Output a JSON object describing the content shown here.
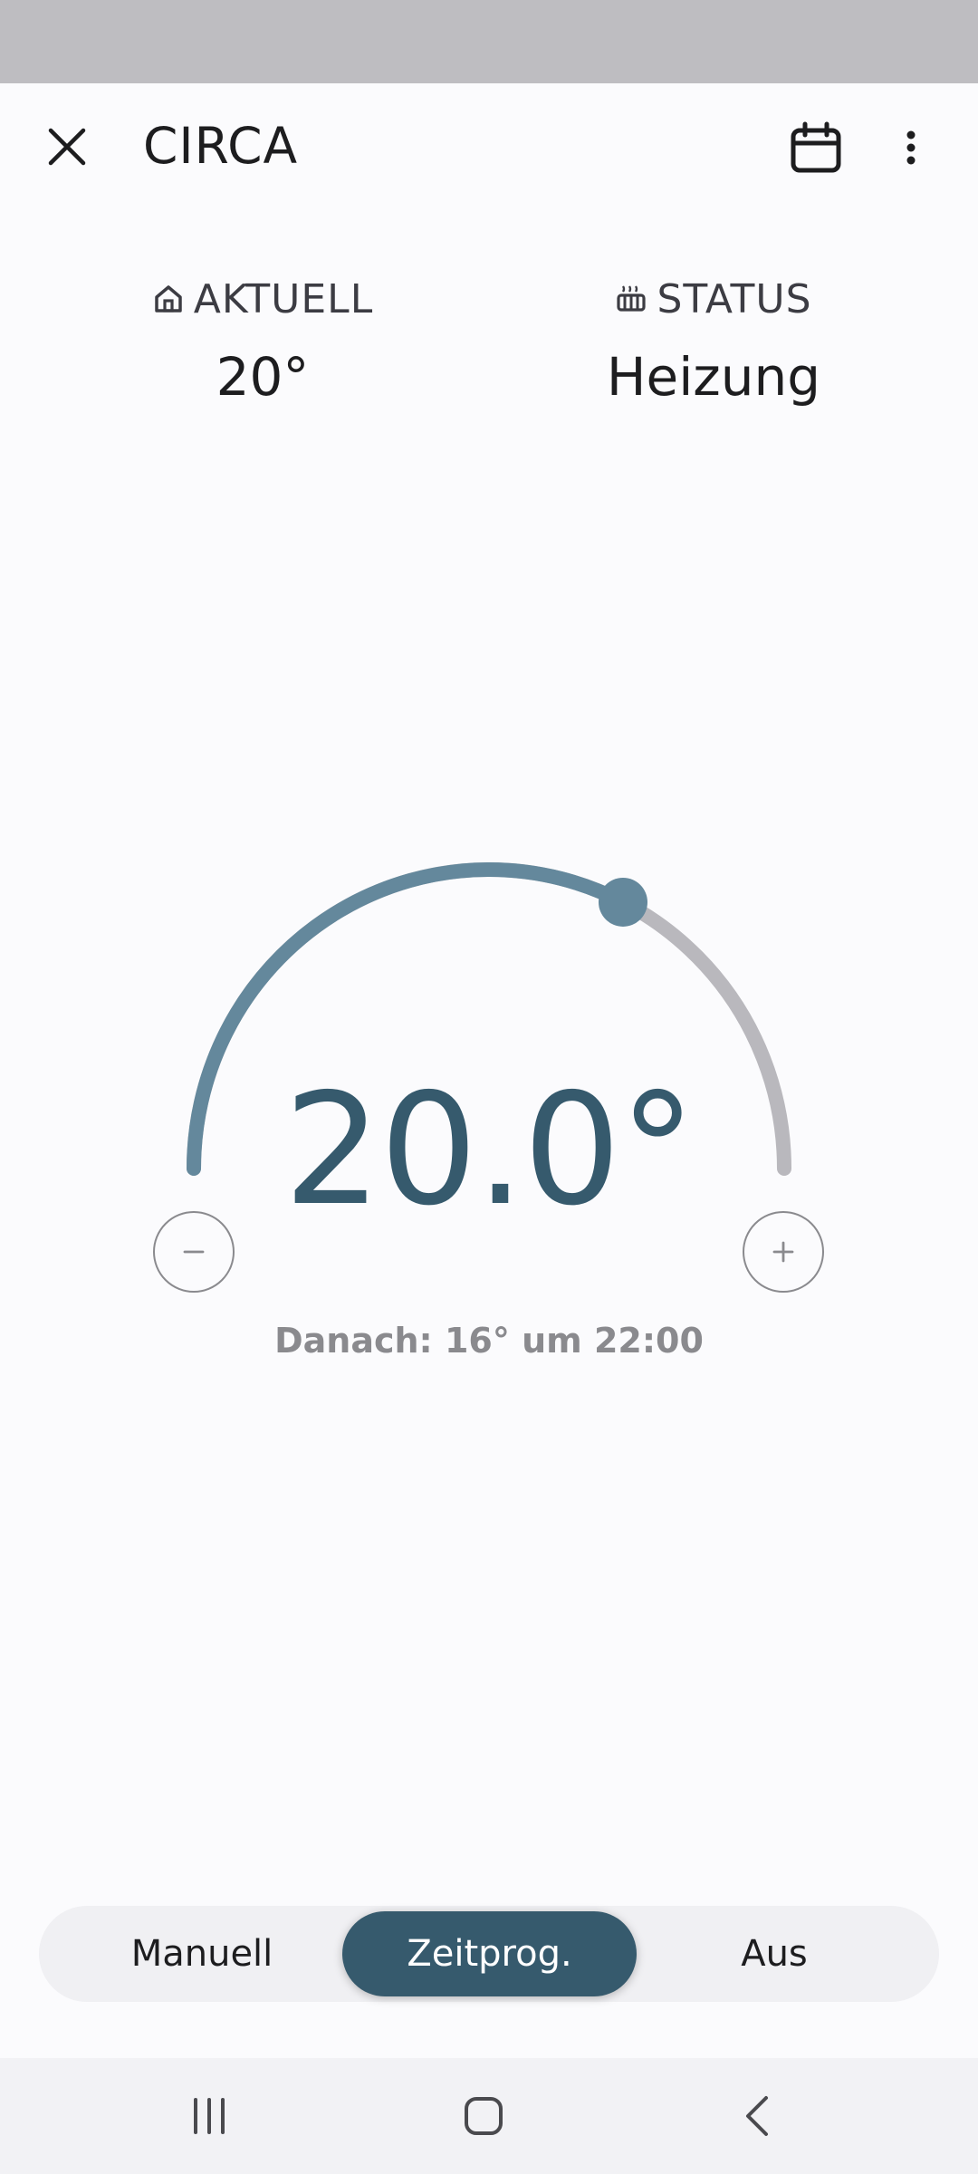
{
  "app_bar": {
    "title": "CIRCA",
    "close_icon": "close-icon",
    "calendar_icon": "calendar-icon",
    "more_icon": "more-vertical-icon"
  },
  "info": {
    "current_label": "AKTUELL",
    "current_icon": "home-icon",
    "current_value": "20°",
    "status_label": "STATUS",
    "status_icon": "heater-icon",
    "status_value": "Heizung"
  },
  "thermostat": {
    "setpoint": "20.0°",
    "dial_fill_fraction": 0.65,
    "next_change": "Danach: 16° um 22:00",
    "minus_icon": "minus-icon",
    "plus_icon": "plus-icon"
  },
  "modes": {
    "items": [
      "Manuell",
      "Zeitprog.",
      "Aus"
    ],
    "active": "Zeitprog."
  },
  "colors": {
    "accent": "#365a6d",
    "dial_fill": "#64889c",
    "dial_track": "#b9b8bd",
    "status_bar": "#bebdc1"
  },
  "system_nav": {
    "recents_icon": "recents-icon",
    "home_icon": "home-circle-icon",
    "back_icon": "back-chevron-icon"
  }
}
